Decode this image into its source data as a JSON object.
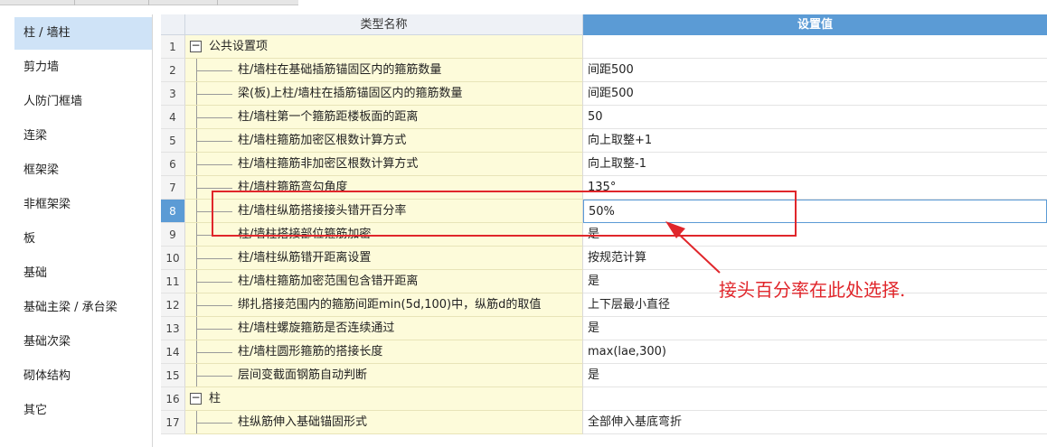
{
  "sidebar": {
    "items": [
      {
        "label": "柱 / 墙柱",
        "active": true
      },
      {
        "label": "剪力墙"
      },
      {
        "label": "人防门框墙"
      },
      {
        "label": "连梁"
      },
      {
        "label": "框架梁"
      },
      {
        "label": "非框架梁"
      },
      {
        "label": "板"
      },
      {
        "label": "基础"
      },
      {
        "label": "基础主梁 / 承台梁"
      },
      {
        "label": "基础次梁"
      },
      {
        "label": "砌体结构"
      },
      {
        "label": "其它"
      }
    ]
  },
  "grid": {
    "header": {
      "name": "类型名称",
      "value": "设置值"
    },
    "rows": [
      {
        "num": "1",
        "name": "公共设置项",
        "value": "",
        "group": true,
        "expander": "−"
      },
      {
        "num": "2",
        "name": "柱/墙柱在基础插筋锚固区内的箍筋数量",
        "value": "间距500"
      },
      {
        "num": "3",
        "name": "梁(板)上柱/墙柱在插筋锚固区内的箍筋数量",
        "value": "间距500"
      },
      {
        "num": "4",
        "name": "柱/墙柱第一个箍筋距楼板面的距离",
        "value": "50"
      },
      {
        "num": "5",
        "name": "柱/墙柱箍筋加密区根数计算方式",
        "value": "向上取整+1"
      },
      {
        "num": "6",
        "name": "柱/墙柱箍筋非加密区根数计算方式",
        "value": "向上取整-1"
      },
      {
        "num": "7",
        "name": "柱/墙柱箍筋弯勾角度",
        "value": "135°"
      },
      {
        "num": "8",
        "name": "柱/墙柱纵筋搭接接头错开百分率",
        "value": "50%",
        "selected": true
      },
      {
        "num": "9",
        "name": "柱/墙柱搭接部位箍筋加密",
        "value": "是"
      },
      {
        "num": "10",
        "name": "柱/墙柱纵筋错开距离设置",
        "value": "按规范计算"
      },
      {
        "num": "11",
        "name": "柱/墙柱箍筋加密范围包含错开距离",
        "value": "是"
      },
      {
        "num": "12",
        "name": "绑扎搭接范围内的箍筋间距min(5d,100)中，纵筋d的取值",
        "value": "上下层最小直径"
      },
      {
        "num": "13",
        "name": "柱/墙柱螺旋箍筋是否连续通过",
        "value": "是"
      },
      {
        "num": "14",
        "name": "柱/墙柱圆形箍筋的搭接长度",
        "value": "max(lae,300)"
      },
      {
        "num": "15",
        "name": "层间变截面钢筋自动判断",
        "value": "是"
      },
      {
        "num": "16",
        "name": "柱",
        "value": "",
        "group": true,
        "expander": "−"
      },
      {
        "num": "17",
        "name": "柱纵筋伸入基础锚固形式",
        "value": "全部伸入基底弯折"
      }
    ]
  },
  "annotation": {
    "text": "接头百分率在此处选择.",
    "color": "#e0262b"
  },
  "colors": {
    "selection": "#5b9bd5",
    "name_column_bg": "#fdfbda",
    "sidebar_active_bg": "#cfe3f7"
  }
}
